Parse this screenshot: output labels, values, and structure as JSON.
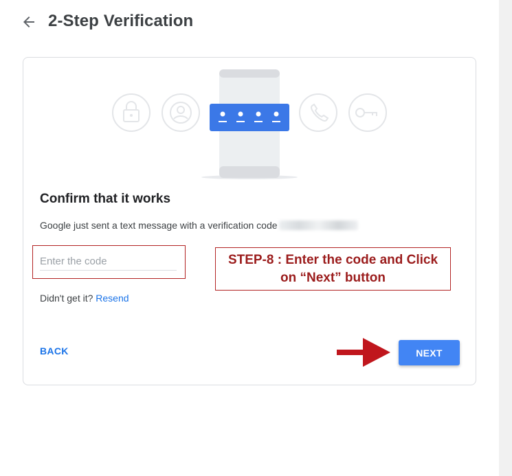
{
  "header": {
    "title": "2-Step Verification",
    "back_icon": "arrow-back-icon"
  },
  "card": {
    "illustration": {
      "icons": [
        "lock-icon",
        "account-icon",
        "phone-icon",
        "key-icon"
      ],
      "code_dots": 4
    },
    "heading": "Confirm that it works",
    "description": "Google just sent a text message with a verification code",
    "code_input": {
      "placeholder": "Enter the code",
      "value": ""
    },
    "resend_prompt": "Didn't get it?",
    "resend_link": "Resend",
    "back_label": "BACK",
    "next_label": "NEXT"
  },
  "annotation": {
    "callout_line1": "STEP-8 : Enter the code and  Click",
    "callout_line2": "on “Next” button",
    "color": "#b22222"
  },
  "colors": {
    "accent": "#1a73e8",
    "next_button": "#4285f4",
    "annotation": "#b22222"
  }
}
